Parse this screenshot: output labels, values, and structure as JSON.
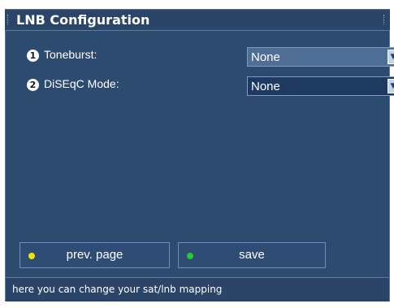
{
  "window": {
    "title": "LNB Configuration"
  },
  "options": [
    {
      "badge": "1",
      "label": "Toneburst:",
      "value": "None",
      "arrow_icon": "chevron-down-icon"
    },
    {
      "badge": "2",
      "label": "DiSEqC Mode:",
      "value": "None",
      "arrow_icon": "chevron-down-icon"
    }
  ],
  "buttons": {
    "prev": {
      "label": "prev. page",
      "dot_color": "#f2e600"
    },
    "save": {
      "label": "save",
      "dot_color": "#1fcf2a"
    }
  },
  "status": {
    "text": "here you can change your sat/lnb mapping"
  },
  "colors": {
    "panel": "#2d4a6f",
    "title_bar": "#2b4569",
    "focused_select": "#4f6e96"
  }
}
